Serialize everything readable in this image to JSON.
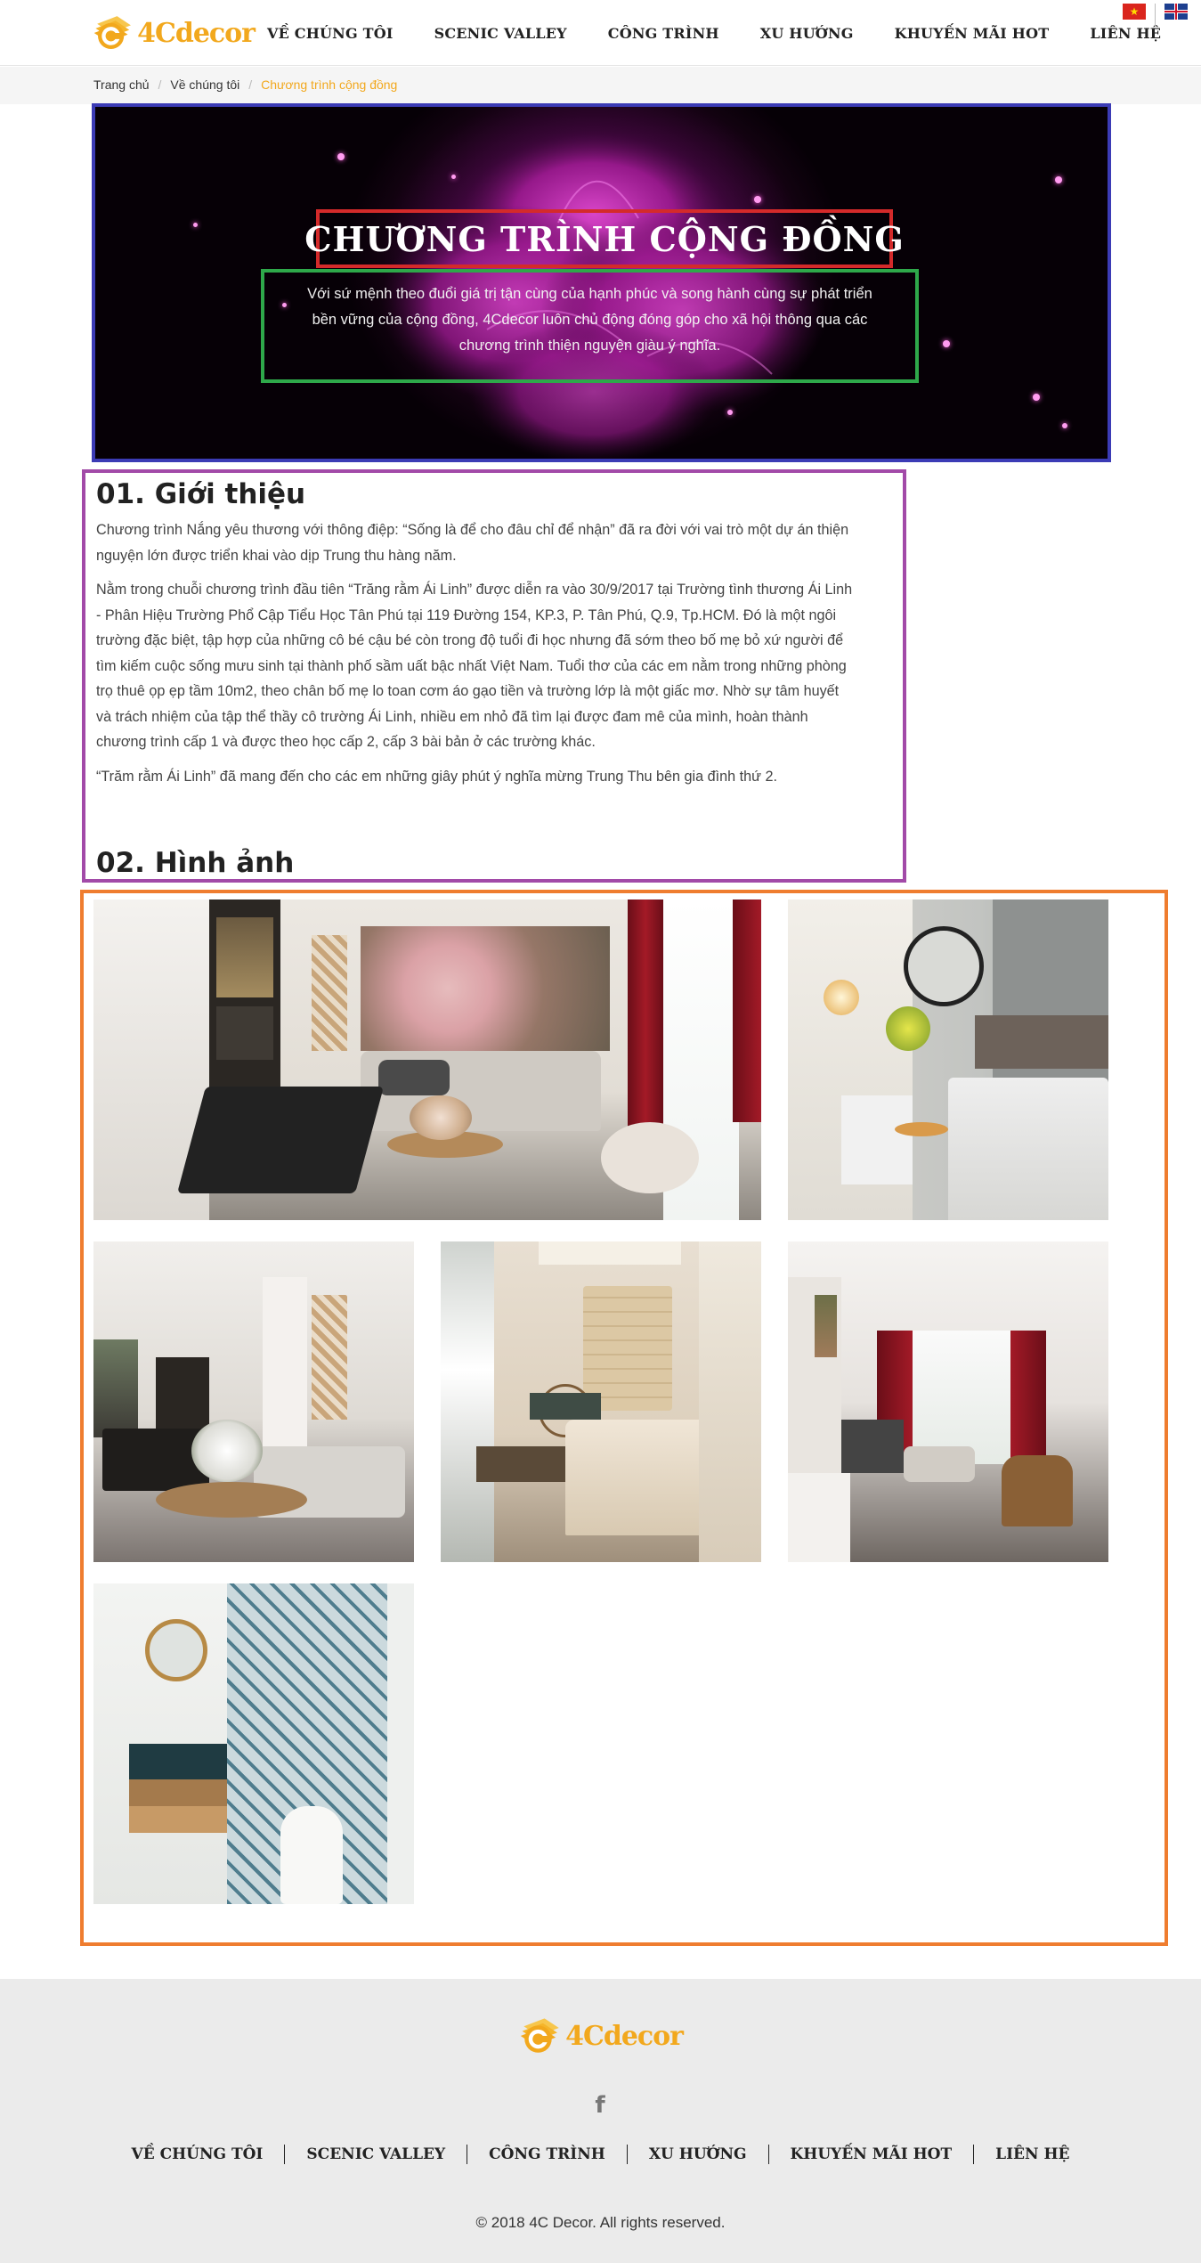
{
  "brand": {
    "name": "4Cdecor",
    "color": "#f2a81d"
  },
  "nav": {
    "items": [
      "VỀ CHÚNG TÔI",
      "SCENIC VALLEY",
      "CÔNG TRÌNH",
      "XU HƯỚNG",
      "KHUYẾN MÃI HOT",
      "LIÊN HỆ"
    ]
  },
  "languages": [
    {
      "code": "vi",
      "icon": "vietnam-flag-icon"
    },
    {
      "code": "en",
      "icon": "uk-flag-icon"
    }
  ],
  "breadcrumb": {
    "home": "Trang chủ",
    "parent": "Về chúng tôi",
    "current": "Chương trình cộng đồng"
  },
  "hero": {
    "title": "CHƯƠNG TRÌNH CỘNG ĐỒNG",
    "description": "Với sứ mệnh theo đuổi giá trị tận cùng của hạnh phúc và song hành cùng sự phát triển bền vững của cộng đồng, 4Cdecor luôn chủ động đóng góp cho xã hội thông qua các chương trình thiện nguyện giàu ý nghĩa."
  },
  "intro": {
    "heading": "01. Giới thiệu",
    "paragraphs": [
      "Chương trình Nắng yêu thương với thông điệp: “Sống là để cho đâu chỉ để nhận” đã ra đời với vai trò một dự án thiện nguyện lớn được triển khai vào dịp Trung thu hàng năm.",
      "Nằm trong chuỗi chương trình đầu tiên “Trăng rằm Ái Linh” được diễn ra vào 30/9/2017 tại Trường tình thương Ái Linh - Phân Hiệu Trường Phổ Cập Tiểu Học Tân Phú  tại 119 Đường 154, KP.3, P. Tân Phú, Q.9, Tp.HCM. Đó là một ngôi trường đặc biệt, tập hợp của những cô bé cậu bé còn trong độ tuổi đi học nhưng đã sớm theo bố mẹ bỏ xứ người để tìm kiếm cuộc sống mưu sinh tại thành phố sầm uất bậc nhất Việt Nam. Tuổi thơ của các em nằm trong những phòng trọ thuê ọp ẹp tầm 10m2, theo chân bố mẹ lo toan cơm áo gạo tiền và trường lớp là một giấc mơ. Nhờ sự tâm huyết và trách nhiệm của tập thể thầy cô trường Ái Linh, nhiều em nhỏ đã tìm lại được đam mê của mình, hoàn thành chương trình cấp 1 và được theo học cấp 2, cấp 3 bài bản ở các trường khác.",
      "“Trăm rằm Ái Linh” đã mang đến cho các em những giây phút ý nghĩa mừng Trung Thu bên gia đình thứ 2."
    ]
  },
  "gallery": {
    "heading": "02. Hình ảnh",
    "photos": [
      {
        "name": "living-room-photo"
      },
      {
        "name": "bedroom-mirror-photo"
      },
      {
        "name": "dining-living-photo"
      },
      {
        "name": "master-bedroom-photo"
      },
      {
        "name": "open-living-kitchen-photo"
      },
      {
        "name": "bathroom-photo"
      }
    ]
  },
  "footer": {
    "social_icon": "facebook-icon",
    "nav": [
      "VỀ CHÚNG TÔI",
      "SCENIC VALLEY",
      "CÔNG TRÌNH",
      "XU HƯỚNG",
      "KHUYẾN MÃI HOT",
      "LIÊN HỆ"
    ],
    "copyright": "© 2018 4C Decor. All rights reserved."
  }
}
